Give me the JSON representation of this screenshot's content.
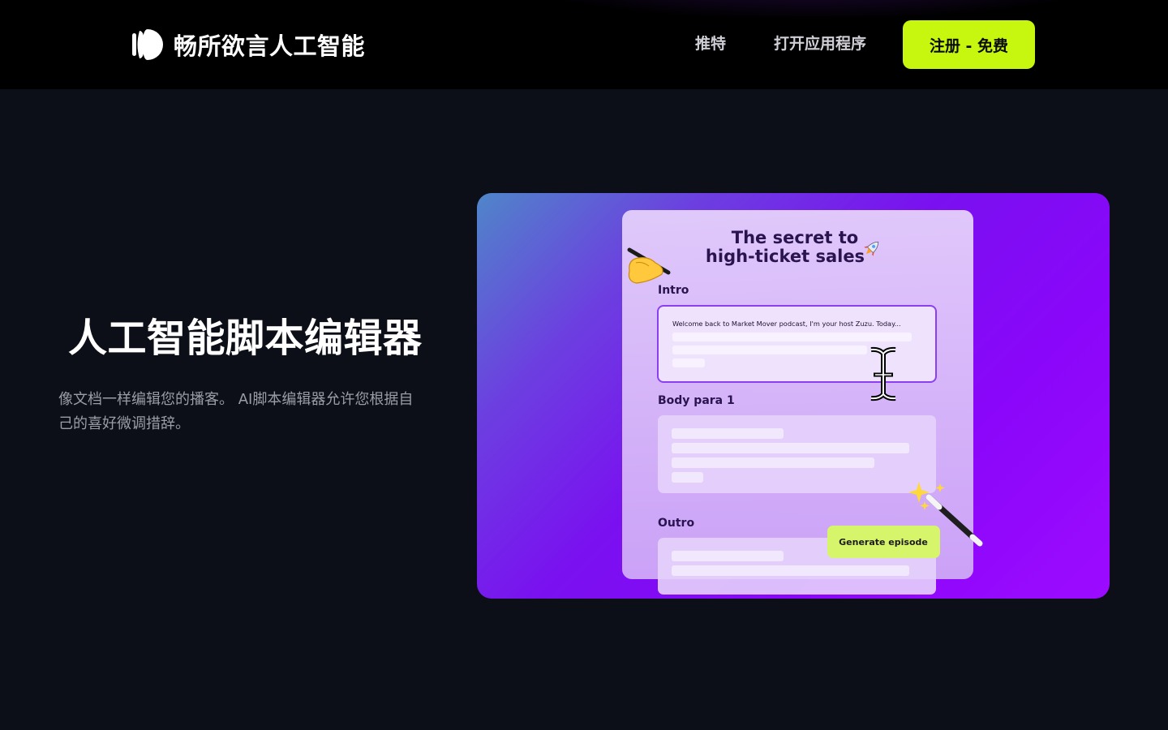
{
  "header": {
    "brand": "畅所欲言人工智能",
    "nav": {
      "twitter": "推特",
      "open_app": "打开应用程序"
    },
    "signup_label": "注册 - 免费"
  },
  "hero": {
    "title": "人工智能脚本编辑器",
    "description": "像文档一样编辑您的播客。 AI脚本编辑器允许您根据自己的喜好微调措辞。"
  },
  "mockup": {
    "title_line1": "The secret to",
    "title_line2": "high-ticket sales",
    "sections": {
      "intro": "Intro",
      "body": "Body para 1",
      "outro": "Outro"
    },
    "intro_text": "Welcome back to Market Mover podcast, I'm your host Zuzu. Today...",
    "generate_label": "Generate episode"
  },
  "colors": {
    "accent": "#c7f70f",
    "background": "#0c0f17",
    "header": "#000000"
  },
  "icons": [
    "logo-icon",
    "writing-hand-icon",
    "rocket-icon",
    "text-cursor-icon",
    "magic-wand-icon",
    "sparkles-icon"
  ]
}
